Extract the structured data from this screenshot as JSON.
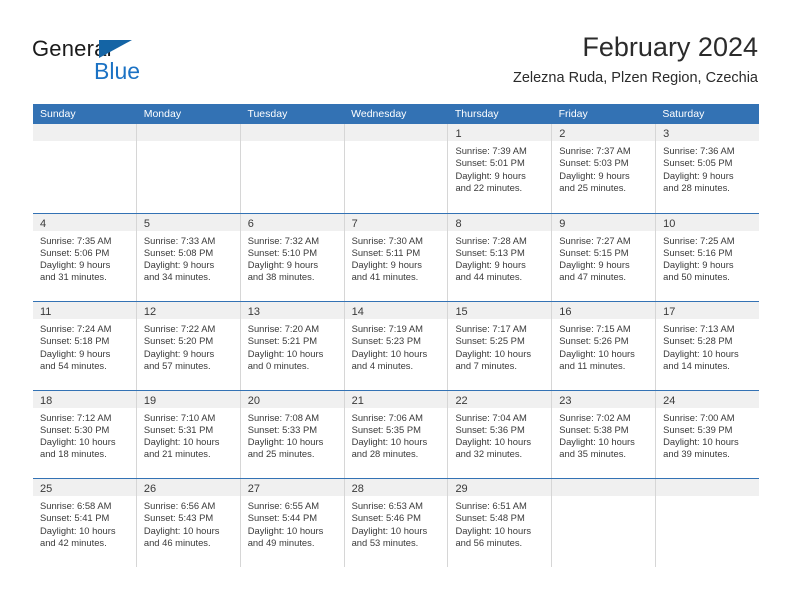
{
  "brand": {
    "general": "General",
    "blue": "Blue",
    "triangle_color": "#1464a5",
    "blue_text_color": "#1b72c4"
  },
  "header": {
    "title": "February 2024",
    "subtitle": "Zelezna Ruda, Plzen Region, Czechia"
  },
  "theme": {
    "header_blue": "#3372b4",
    "day_strip_gray": "#f0f0f0",
    "grid_gray": "#d6d6d6"
  },
  "weekdays": [
    "Sunday",
    "Monday",
    "Tuesday",
    "Wednesday",
    "Thursday",
    "Friday",
    "Saturday"
  ],
  "weeks": [
    [
      {
        "day": "",
        "lines": []
      },
      {
        "day": "",
        "lines": []
      },
      {
        "day": "",
        "lines": []
      },
      {
        "day": "",
        "lines": []
      },
      {
        "day": "1",
        "lines": [
          "Sunrise: 7:39 AM",
          "Sunset: 5:01 PM",
          "Daylight: 9 hours",
          "and 22 minutes."
        ]
      },
      {
        "day": "2",
        "lines": [
          "Sunrise: 7:37 AM",
          "Sunset: 5:03 PM",
          "Daylight: 9 hours",
          "and 25 minutes."
        ]
      },
      {
        "day": "3",
        "lines": [
          "Sunrise: 7:36 AM",
          "Sunset: 5:05 PM",
          "Daylight: 9 hours",
          "and 28 minutes."
        ]
      }
    ],
    [
      {
        "day": "4",
        "lines": [
          "Sunrise: 7:35 AM",
          "Sunset: 5:06 PM",
          "Daylight: 9 hours",
          "and 31 minutes."
        ]
      },
      {
        "day": "5",
        "lines": [
          "Sunrise: 7:33 AM",
          "Sunset: 5:08 PM",
          "Daylight: 9 hours",
          "and 34 minutes."
        ]
      },
      {
        "day": "6",
        "lines": [
          "Sunrise: 7:32 AM",
          "Sunset: 5:10 PM",
          "Daylight: 9 hours",
          "and 38 minutes."
        ]
      },
      {
        "day": "7",
        "lines": [
          "Sunrise: 7:30 AM",
          "Sunset: 5:11 PM",
          "Daylight: 9 hours",
          "and 41 minutes."
        ]
      },
      {
        "day": "8",
        "lines": [
          "Sunrise: 7:28 AM",
          "Sunset: 5:13 PM",
          "Daylight: 9 hours",
          "and 44 minutes."
        ]
      },
      {
        "day": "9",
        "lines": [
          "Sunrise: 7:27 AM",
          "Sunset: 5:15 PM",
          "Daylight: 9 hours",
          "and 47 minutes."
        ]
      },
      {
        "day": "10",
        "lines": [
          "Sunrise: 7:25 AM",
          "Sunset: 5:16 PM",
          "Daylight: 9 hours",
          "and 50 minutes."
        ]
      }
    ],
    [
      {
        "day": "11",
        "lines": [
          "Sunrise: 7:24 AM",
          "Sunset: 5:18 PM",
          "Daylight: 9 hours",
          "and 54 minutes."
        ]
      },
      {
        "day": "12",
        "lines": [
          "Sunrise: 7:22 AM",
          "Sunset: 5:20 PM",
          "Daylight: 9 hours",
          "and 57 minutes."
        ]
      },
      {
        "day": "13",
        "lines": [
          "Sunrise: 7:20 AM",
          "Sunset: 5:21 PM",
          "Daylight: 10 hours",
          "and 0 minutes."
        ]
      },
      {
        "day": "14",
        "lines": [
          "Sunrise: 7:19 AM",
          "Sunset: 5:23 PM",
          "Daylight: 10 hours",
          "and 4 minutes."
        ]
      },
      {
        "day": "15",
        "lines": [
          "Sunrise: 7:17 AM",
          "Sunset: 5:25 PM",
          "Daylight: 10 hours",
          "and 7 minutes."
        ]
      },
      {
        "day": "16",
        "lines": [
          "Sunrise: 7:15 AM",
          "Sunset: 5:26 PM",
          "Daylight: 10 hours",
          "and 11 minutes."
        ]
      },
      {
        "day": "17",
        "lines": [
          "Sunrise: 7:13 AM",
          "Sunset: 5:28 PM",
          "Daylight: 10 hours",
          "and 14 minutes."
        ]
      }
    ],
    [
      {
        "day": "18",
        "lines": [
          "Sunrise: 7:12 AM",
          "Sunset: 5:30 PM",
          "Daylight: 10 hours",
          "and 18 minutes."
        ]
      },
      {
        "day": "19",
        "lines": [
          "Sunrise: 7:10 AM",
          "Sunset: 5:31 PM",
          "Daylight: 10 hours",
          "and 21 minutes."
        ]
      },
      {
        "day": "20",
        "lines": [
          "Sunrise: 7:08 AM",
          "Sunset: 5:33 PM",
          "Daylight: 10 hours",
          "and 25 minutes."
        ]
      },
      {
        "day": "21",
        "lines": [
          "Sunrise: 7:06 AM",
          "Sunset: 5:35 PM",
          "Daylight: 10 hours",
          "and 28 minutes."
        ]
      },
      {
        "day": "22",
        "lines": [
          "Sunrise: 7:04 AM",
          "Sunset: 5:36 PM",
          "Daylight: 10 hours",
          "and 32 minutes."
        ]
      },
      {
        "day": "23",
        "lines": [
          "Sunrise: 7:02 AM",
          "Sunset: 5:38 PM",
          "Daylight: 10 hours",
          "and 35 minutes."
        ]
      },
      {
        "day": "24",
        "lines": [
          "Sunrise: 7:00 AM",
          "Sunset: 5:39 PM",
          "Daylight: 10 hours",
          "and 39 minutes."
        ]
      }
    ],
    [
      {
        "day": "25",
        "lines": [
          "Sunrise: 6:58 AM",
          "Sunset: 5:41 PM",
          "Daylight: 10 hours",
          "and 42 minutes."
        ]
      },
      {
        "day": "26",
        "lines": [
          "Sunrise: 6:56 AM",
          "Sunset: 5:43 PM",
          "Daylight: 10 hours",
          "and 46 minutes."
        ]
      },
      {
        "day": "27",
        "lines": [
          "Sunrise: 6:55 AM",
          "Sunset: 5:44 PM",
          "Daylight: 10 hours",
          "and 49 minutes."
        ]
      },
      {
        "day": "28",
        "lines": [
          "Sunrise: 6:53 AM",
          "Sunset: 5:46 PM",
          "Daylight: 10 hours",
          "and 53 minutes."
        ]
      },
      {
        "day": "29",
        "lines": [
          "Sunrise: 6:51 AM",
          "Sunset: 5:48 PM",
          "Daylight: 10 hours",
          "and 56 minutes."
        ]
      },
      {
        "day": "",
        "lines": []
      },
      {
        "day": "",
        "lines": []
      }
    ]
  ]
}
